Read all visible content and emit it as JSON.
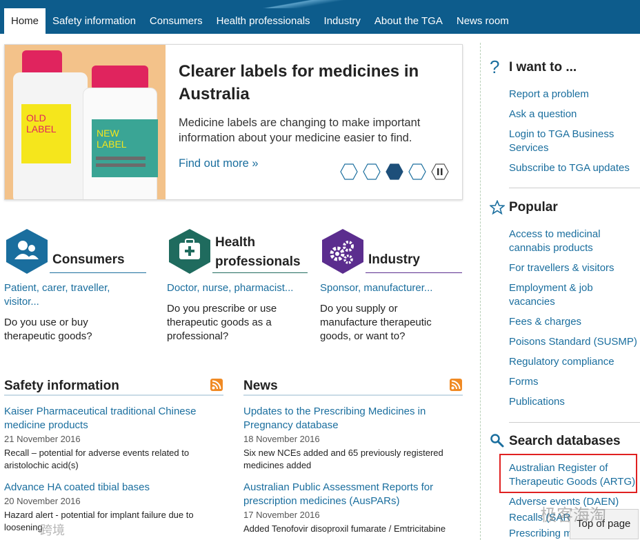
{
  "nav": {
    "items": [
      "Home",
      "Safety information",
      "Consumers",
      "Health professionals",
      "Industry",
      "About the TGA",
      "News room"
    ]
  },
  "hero": {
    "title": "Clearer labels for medicines in Australia",
    "description": "Medicine labels are changing to make important information about your medicine easier to find.",
    "link": "Find out more »",
    "old_label": "OLD LABEL",
    "new_label": "NEW LABEL",
    "active_slide": 3,
    "slide_count": 4
  },
  "audiences": [
    {
      "title": "Consumers",
      "sub": "Patient, carer, traveller, visitor...",
      "question": "Do you use or buy therapeutic goods?"
    },
    {
      "title": "Health professionals",
      "sub": "Doctor, nurse, pharmacist...",
      "question": "Do you prescribe or use therapeutic goods as a professional?"
    },
    {
      "title": "Industry",
      "sub": "Sponsor, manufacturer...",
      "question": "Do you supply or manufacture therapeutic goods, or want to?"
    }
  ],
  "safety": {
    "heading": "Safety information",
    "items": [
      {
        "title": "Kaiser Pharmaceutical traditional Chinese medicine products",
        "date": "21 November 2016",
        "summary": "Recall – potential for adverse events related to aristolochic acid(s)"
      },
      {
        "title": "Advance HA coated tibial bases",
        "date": "20 November 2016",
        "summary": "Hazard alert - potential for implant failure due to loosening"
      }
    ]
  },
  "news": {
    "heading": "News",
    "items": [
      {
        "title": "Updates to the Prescribing Medicines in Pregnancy database",
        "date": "18 November 2016",
        "summary": "Six new NCEs added and 65 previously registered medicines added"
      },
      {
        "title": "Australian Public Assessment Reports for prescription medicines (AusPARs)",
        "date": "17 November 2016",
        "summary": "Added Tenofovir disoproxil fumarate / Emtricitabine"
      }
    ]
  },
  "sidebar": {
    "iwant": {
      "heading": "I want to ...",
      "links": [
        "Report a problem",
        "Ask a question",
        "Login to TGA Business Services",
        "Subscribe to TGA updates"
      ]
    },
    "popular": {
      "heading": "Popular",
      "links": [
        "Access to medicinal cannabis products",
        "For travellers & visitors",
        "Employment & job vacancies",
        "Fees & charges",
        "Poisons Standard (SUSMP)",
        "Regulatory compliance",
        "Forms",
        "Publications"
      ]
    },
    "search": {
      "heading": "Search databases",
      "links": [
        "Australian Register of Therapeutic Goods (ARTG)",
        "Adverse events (DAEN)",
        "Recalls (SARA)",
        "Prescribing medicines in"
      ]
    }
  },
  "top_of_page": "Top of page",
  "watermarks": [
    "极客海淘",
    "跨境"
  ],
  "colors": {
    "nav": "#0d5c8c",
    "link": "#1a6e9e",
    "consumers": "#1a6e9e",
    "health": "#1f6b5e",
    "industry": "#5b2d8e",
    "highlight": "#e02020",
    "rss": "#f08a24"
  }
}
